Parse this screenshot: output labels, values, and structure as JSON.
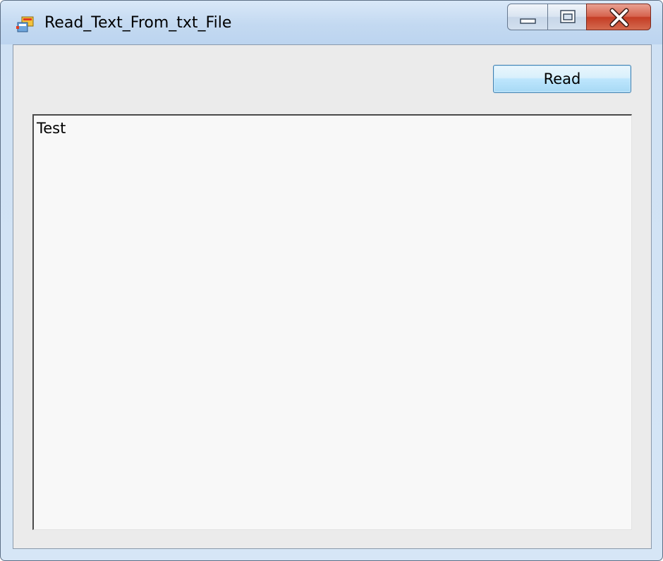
{
  "window": {
    "title": "Read_Text_From_txt_File",
    "caption": {
      "minimize_icon": "minimize-icon",
      "maximize_icon": "maximize-icon",
      "close_icon": "close-icon"
    }
  },
  "form": {
    "read_button_label": "Read",
    "textbox_value": "Test"
  }
}
